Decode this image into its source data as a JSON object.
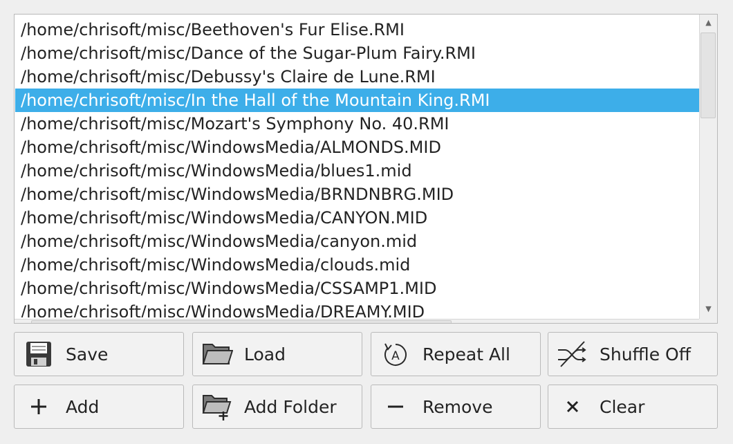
{
  "playlist": {
    "selected_index": 3,
    "items": [
      "/home/chrisoft/misc/Beethoven's Fur Elise.RMI",
      "/home/chrisoft/misc/Dance of the Sugar-Plum Fairy.RMI",
      "/home/chrisoft/misc/Debussy's Claire de Lune.RMI",
      "/home/chrisoft/misc/In the Hall of the Mountain King.RMI",
      "/home/chrisoft/misc/Mozart's Symphony No. 40.RMI",
      "/home/chrisoft/misc/WindowsMedia/ALMONDS.MID",
      "/home/chrisoft/misc/WindowsMedia/blues1.mid",
      "/home/chrisoft/misc/WindowsMedia/BRNDNBRG.MID",
      "/home/chrisoft/misc/WindowsMedia/CANYON.MID",
      "/home/chrisoft/misc/WindowsMedia/canyon.mid",
      "/home/chrisoft/misc/WindowsMedia/clouds.mid",
      "/home/chrisoft/misc/WindowsMedia/CSSAMP1.MID",
      "/home/chrisoft/misc/WindowsMedia/DREAMY.MID"
    ]
  },
  "buttons": {
    "save": "Save",
    "load": "Load",
    "repeat": "Repeat All",
    "shuffle": "Shuffle Off",
    "add": "Add",
    "add_folder": "Add Folder",
    "remove": "Remove",
    "clear": "Clear"
  },
  "icons": {
    "save": "floppy-disk-icon",
    "load": "folder-open-icon",
    "repeat": "repeat-all-icon",
    "shuffle": "shuffle-off-icon",
    "add": "plus-icon",
    "add_folder": "folder-add-icon",
    "remove": "minus-icon",
    "clear": "close-icon"
  },
  "colors": {
    "selection": "#3daee9",
    "selection_text": "#ffffff"
  }
}
